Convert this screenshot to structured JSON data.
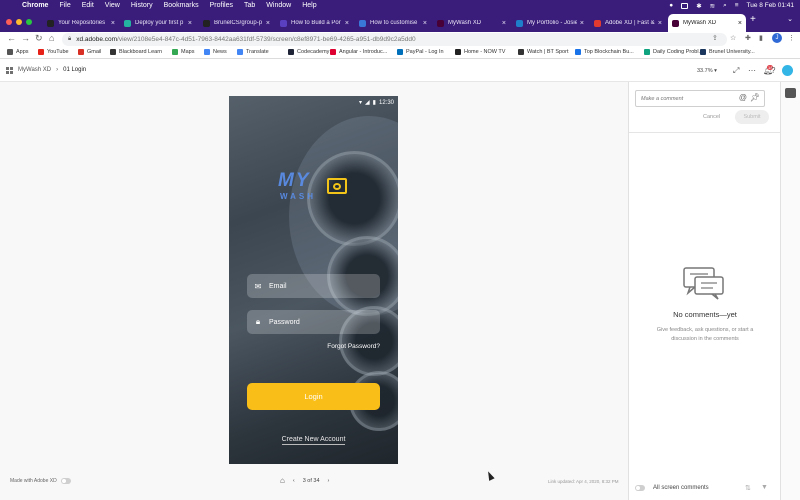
{
  "menubar": {
    "items": [
      "Chrome",
      "File",
      "Edit",
      "View",
      "History",
      "Bookmarks",
      "Profiles",
      "Tab",
      "Window",
      "Help"
    ],
    "clock": "Tue 8 Feb  01:41"
  },
  "tabs": [
    {
      "title": "Your Repositories",
      "color": "#222222"
    },
    {
      "title": "Deploy your first p",
      "color": "#24b3a1"
    },
    {
      "title": "BrunelCS/group-p",
      "color": "#222222"
    },
    {
      "title": "How to Build a Por",
      "color": "#5a3fc0"
    },
    {
      "title": "How to customise",
      "color": "#3a78d8"
    },
    {
      "title": "MyWash XD",
      "color": "#470137"
    },
    {
      "title": "My Portfolio - Josie",
      "color": "#1f7ec9"
    },
    {
      "title": "Adobe XD | Fast &",
      "color": "#e23a2f"
    },
    {
      "title": "MyWash XD",
      "color": "#470137"
    }
  ],
  "address": {
    "url_main": "xd.adobe.com",
    "url_rest": "/view/2108e5e4-847c-4d51-7963-8442aa631fdf-5739/screen/c8ef8971-be69-4265-a951-db9d9c2a5dd0"
  },
  "bookmarks": [
    {
      "label": "Apps",
      "color": "#555555"
    },
    {
      "label": "YouTube",
      "color": "#e62117"
    },
    {
      "label": "Gmail",
      "color": "#d93025"
    },
    {
      "label": "Blackboard Learn",
      "color": "#333333"
    },
    {
      "label": "Maps",
      "color": "#34a853"
    },
    {
      "label": "News",
      "color": "#4285f4"
    },
    {
      "label": "Translate",
      "color": "#4285f4"
    },
    {
      "label": "Codecademy",
      "color": "#1f2436"
    },
    {
      "label": "Angular - Introduc...",
      "color": "#dd0031"
    },
    {
      "label": "PayPal - Log In",
      "color": "#0070ba"
    },
    {
      "label": "Home - NOW TV",
      "color": "#222222"
    },
    {
      "label": "Watch | BT Sport",
      "color": "#333333"
    },
    {
      "label": "Top Blockchain Bu...",
      "color": "#1a73e8"
    },
    {
      "label": "Daily Coding Probl...",
      "color": "#10a37f"
    },
    {
      "label": "Brunel University...",
      "color": "#1b365d"
    }
  ],
  "xd": {
    "project": "MyWash XD",
    "screen": "01 Login",
    "zoom": "33.7%",
    "notifications": "14"
  },
  "phone": {
    "time": "12:30",
    "logo_my": "MY",
    "logo_wash": "WASH",
    "email_placeholder": "Email",
    "password_placeholder": "Password",
    "forgot": "Forgot Password?",
    "login": "Login",
    "create": "Create New Account",
    "accent": "#f9be17"
  },
  "footer": {
    "made_with": "Made with Adobe XD",
    "page": "3 of 34",
    "last_updated": "Link updated: Apr 4, 2020, 8:32 PM"
  },
  "comments": {
    "placeholder": "Make a comment",
    "cancel": "Cancel",
    "submit": "Submit",
    "empty_title": "No comments—yet",
    "empty_body": "Give feedback, ask questions, or start a discussion in the comments",
    "all_screens": "All screen comments"
  }
}
